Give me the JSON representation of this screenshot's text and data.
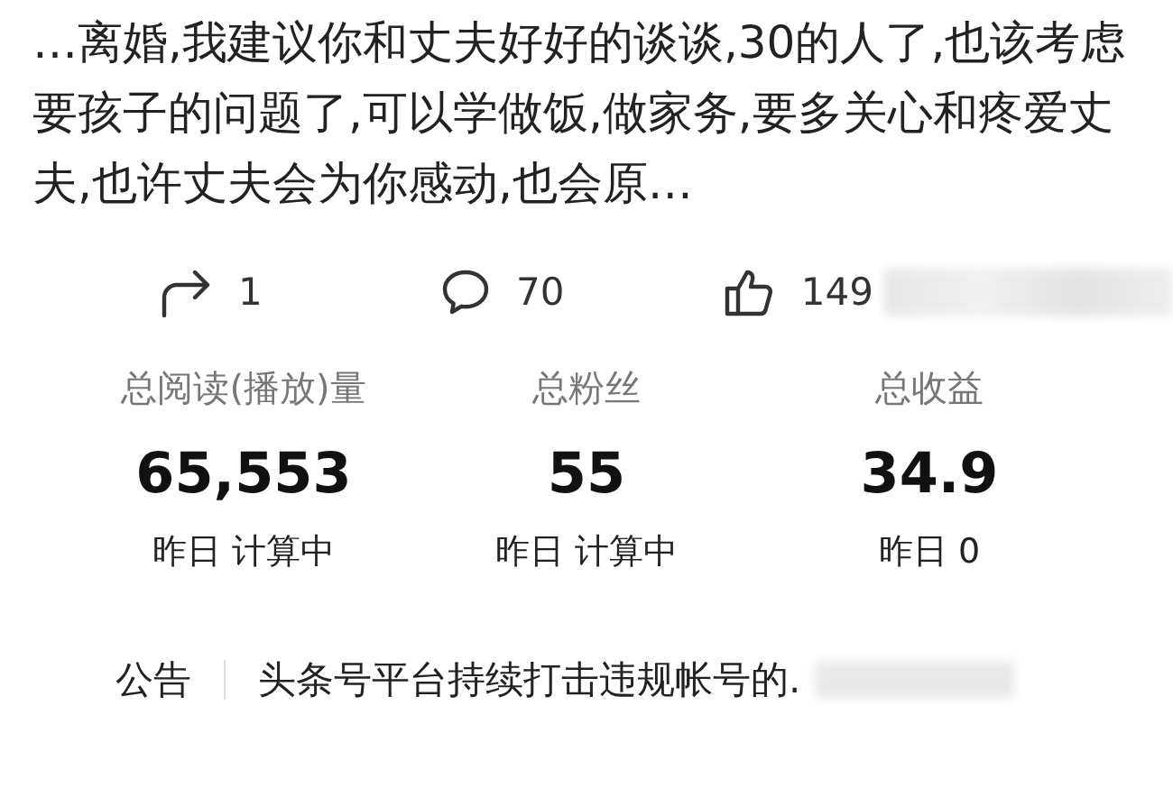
{
  "post": {
    "excerpt": "…离婚,我建议你和丈夫好好的谈谈,30的人了,也该考虑要孩子的问题了,可以学做饭,做家务,要多关心和疼爱丈夫,也许丈夫会为你感动,也会原…"
  },
  "actions": [
    {
      "kind": "share",
      "count": "1"
    },
    {
      "kind": "comment",
      "count": "70"
    },
    {
      "kind": "like",
      "count": "149"
    }
  ],
  "stats": [
    {
      "label": "总阅读(播放)量",
      "value": "65,553",
      "yesterday": "昨日 计算中"
    },
    {
      "label": "总粉丝",
      "value": "55",
      "yesterday": "昨日 计算中"
    },
    {
      "label": "总收益",
      "value": "34.9",
      "yesterday": "昨日 0"
    }
  ],
  "notice": {
    "tag": "公告",
    "text": "头条号平台持续打击违规帐号的."
  }
}
